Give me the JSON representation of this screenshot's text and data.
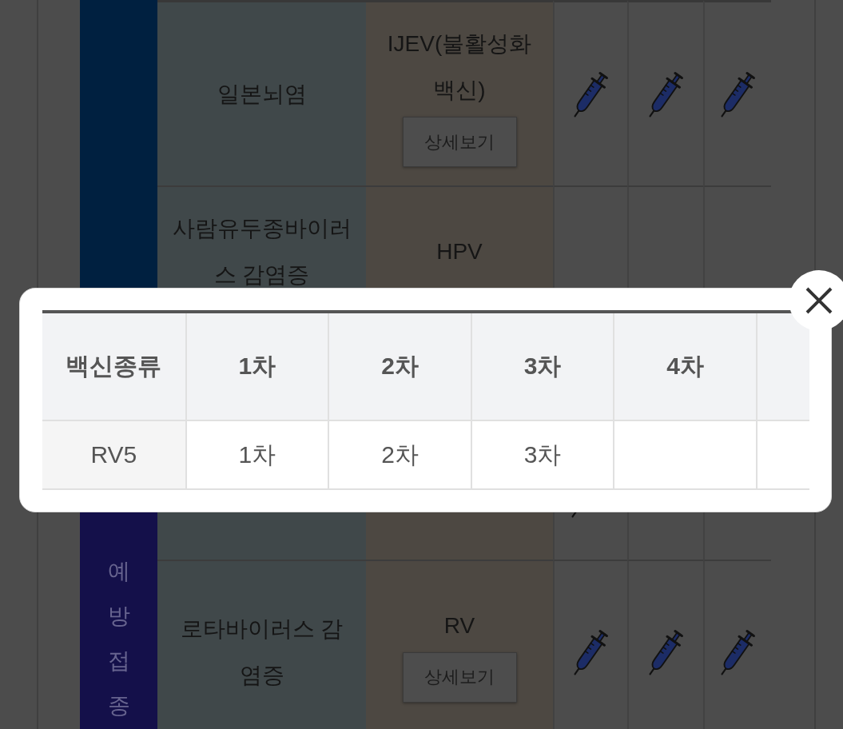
{
  "schedule_table": {
    "groups": [
      {
        "color": "#002040",
        "rows": [
          {
            "disease": "일본뇌염",
            "vaccine": "IJEV(불활성화 백신)",
            "detail_button": "상세보기",
            "doses": [
              {
                "syringe": true
              },
              {
                "syringe": true
              },
              {
                "syringe": true
              }
            ]
          },
          {
            "disease": "사람유두종바이러스 감염증",
            "vaccine": "HPV",
            "doses": [
              {
                "syringe": false
              },
              {
                "syringe": false
              },
              {
                "syringe": false
              }
            ]
          }
        ]
      },
      {
        "color": "#14104a",
        "label": "예방접종",
        "rows": [
          {
            "doses": [
              {
                "syringe": true
              },
              {
                "syringe": false
              },
              {
                "syringe": false
              }
            ]
          },
          {
            "disease": "로타바이러스 감염증",
            "vaccine": "RV",
            "detail_button": "상세보기",
            "doses": [
              {
                "syringe": true
              },
              {
                "syringe": true
              },
              {
                "syringe": true
              }
            ]
          }
        ]
      }
    ]
  },
  "modal": {
    "table": {
      "columns": [
        "백신종류",
        "1차",
        "2차",
        "3차",
        "4차"
      ],
      "rows": [
        {
          "cells": [
            "RV5",
            "1차",
            "2차",
            "3차"
          ]
        }
      ]
    }
  }
}
